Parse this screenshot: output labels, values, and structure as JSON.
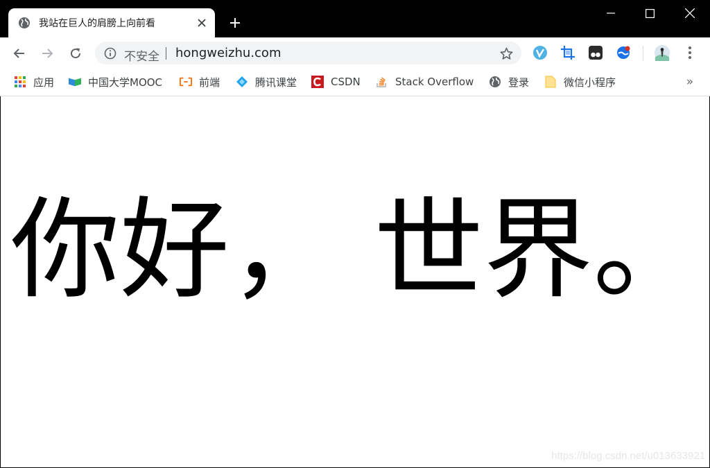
{
  "tab": {
    "title": "我站在巨人的肩膀上向前看",
    "favicon": "globe-icon"
  },
  "window": {
    "controls": [
      "minimize-icon",
      "maximize-icon",
      "close-icon"
    ]
  },
  "toolbar": {
    "security_label": "不安全",
    "url": "hongweizhu.com",
    "extensions": [
      "v-extension-icon",
      "crop-extension-icon",
      "tampermonkey-icon",
      "chrome-extension-icon"
    ]
  },
  "bookmarks": [
    {
      "label": "应用",
      "icon": "apps-grid-icon"
    },
    {
      "label": "中国大学MOOC",
      "icon": "mooc-icon"
    },
    {
      "label": "前端",
      "icon": "aliyun-icon"
    },
    {
      "label": "腾讯课堂",
      "icon": "tencent-classroom-icon"
    },
    {
      "label": "CSDN",
      "icon": "csdn-icon"
    },
    {
      "label": "Stack Overflow",
      "icon": "stackoverflow-icon"
    },
    {
      "label": "登录",
      "icon": "globe-icon"
    },
    {
      "label": "微信小程序",
      "icon": "folder-icon"
    }
  ],
  "page": {
    "headline": "你好， 世界。",
    "watermark": "https://blog.csdn.net/u013633921"
  },
  "colors": {
    "titlebar": "#000000",
    "toolbar": "#ffffff",
    "omnibox": "#f1f3f4",
    "csdn_red": "#c9171e",
    "aliyun_orange": "#ff6a00"
  }
}
